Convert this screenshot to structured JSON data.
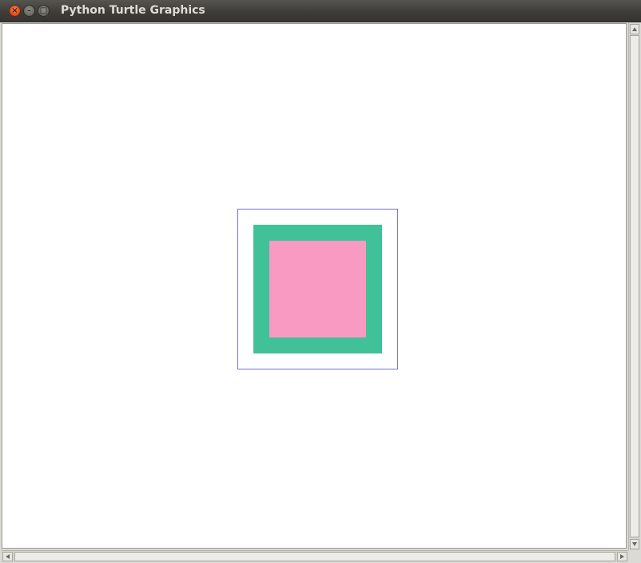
{
  "window": {
    "title": "Python Turtle Graphics",
    "buttons": {
      "close_glyph": "×",
      "minimize_glyph": "–",
      "maximize_glyph": "□"
    }
  },
  "colors": {
    "outline": "#7070e0",
    "outer_fill": "#41c198",
    "inner_fill": "#f89ac2",
    "canvas_bg": "#ffffff"
  },
  "icons": {
    "close": "close-icon",
    "minimize": "minimize-icon",
    "maximize": "maximize-icon",
    "scroll_up": "arrow-up-icon",
    "scroll_down": "arrow-down-icon",
    "scroll_left": "arrow-left-icon",
    "scroll_right": "arrow-right-icon"
  }
}
